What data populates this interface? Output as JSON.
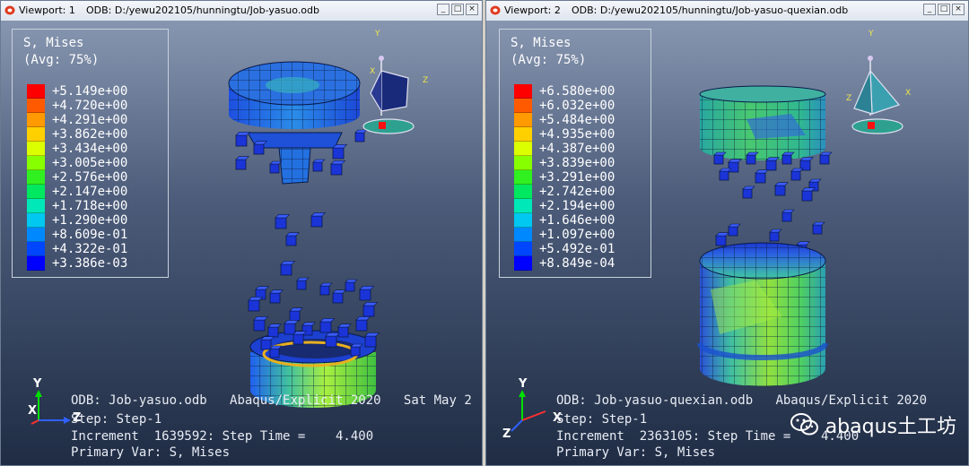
{
  "viewports": [
    {
      "title": "Viewport: 1",
      "odb_path": "ODB: D:/yewu202105/hunningtu/Job-yasuo.odb",
      "legend": {
        "title": "S, Mises",
        "subtitle": "(Avg: 75%)",
        "values": [
          "+5.149e+00",
          "+4.720e+00",
          "+4.291e+00",
          "+3.862e+00",
          "+3.434e+00",
          "+3.005e+00",
          "+2.576e+00",
          "+2.147e+00",
          "+1.718e+00",
          "+1.290e+00",
          "+8.609e-01",
          "+4.322e-01",
          "+3.386e-03"
        ]
      },
      "info": {
        "odb": "ODB: Job-yasuo.odb",
        "solver": "Abaqus/Explicit 2020",
        "date": "Sat May 2",
        "step": "Step: Step-1",
        "increment": "Increment  1639592: Step Time =    4.400",
        "primary_var": "Primary Var: S, Mises"
      },
      "axes": {
        "y": "Y",
        "x": "X",
        "z": "Z"
      }
    },
    {
      "title": "Viewport: 2",
      "odb_path": "ODB: D:/yewu202105/hunningtu/Job-yasuo-quexian.odb",
      "legend": {
        "title": "S, Mises",
        "subtitle": "(Avg: 75%)",
        "values": [
          "+6.580e+00",
          "+6.032e+00",
          "+5.484e+00",
          "+4.935e+00",
          "+4.387e+00",
          "+3.839e+00",
          "+3.291e+00",
          "+2.742e+00",
          "+2.194e+00",
          "+1.646e+00",
          "+1.097e+00",
          "+5.492e-01",
          "+8.849e-04"
        ]
      },
      "info": {
        "odb": "ODB: Job-yasuo-quexian.odb",
        "solver": "Abaqus/Explicit 2020",
        "date": "",
        "step": "Step: Step-1",
        "increment": "Increment  2363105: Step Time =    4.400",
        "primary_var": "Primary Var: S, Mises"
      },
      "axes": {
        "y": "Y",
        "x": "X",
        "z": "Z"
      }
    }
  ],
  "legend_colors": [
    "#ff0000",
    "#ff5a00",
    "#ff9a00",
    "#ffd000",
    "#dcff00",
    "#88ff00",
    "#30f020",
    "#00e860",
    "#00e8b8",
    "#00c8f0",
    "#0088ff",
    "#0046ff",
    "#0000ff"
  ],
  "watermark": "abaqus土工坊",
  "window_buttons": [
    "_",
    "□",
    "×"
  ]
}
